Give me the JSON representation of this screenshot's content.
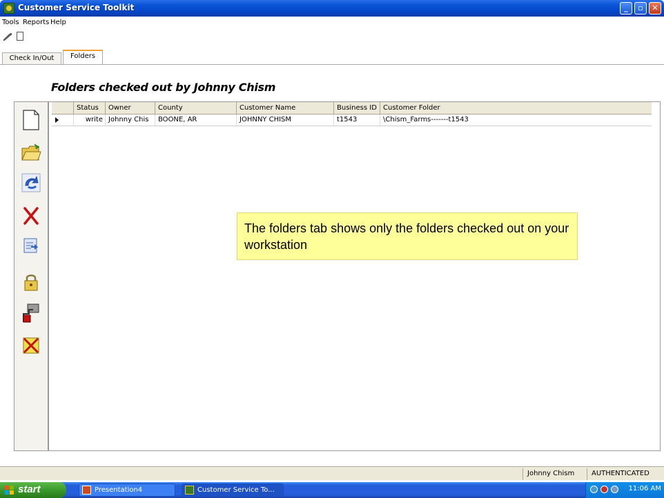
{
  "window": {
    "title": "Customer Service Toolkit",
    "buttons": [
      "_",
      "▫",
      "X"
    ]
  },
  "menu": [
    "Tools",
    "Reports",
    "Help"
  ],
  "tabs": [
    {
      "label": "Check In/Out",
      "active": false
    },
    {
      "label": "Folders",
      "active": true
    }
  ],
  "heading": "Folders checked out by Johnny Chism",
  "sidebar": {
    "icons": [
      "new-document-icon",
      "open-folder-icon",
      "refresh-icon",
      "delete-icon",
      "checkin-icon",
      "lock-icon",
      "transfer-icon",
      "cancel-checkout-icon"
    ]
  },
  "grid": {
    "columns": [
      "Status",
      "Owner",
      "County",
      "Customer Name",
      "Business ID",
      "Customer Folder"
    ],
    "rows": [
      {
        "status": "write",
        "owner": "Johnny Chis",
        "county": "BOONE, AR",
        "customer_name": "JOHNNY CHISM",
        "business_id": "t1543",
        "customer_folder": "\\Chism_Farms-------t1543"
      }
    ]
  },
  "callout": {
    "text": "The folders tab shows only the folders checked out on your workstation"
  },
  "status_bar": {
    "user": "Johnny Chism",
    "auth": "AUTHENTICATED"
  },
  "taskbar": {
    "start_label": "start",
    "tasks": [
      {
        "label": "Presentation4",
        "active": false
      },
      {
        "label": "Customer Service To...",
        "active": true
      }
    ],
    "clock": "11:06 AM"
  },
  "colors": {
    "title_bar": "#0a55d6",
    "callout_bg": "#ffff99",
    "active_tab_accent": "#f0a030"
  }
}
